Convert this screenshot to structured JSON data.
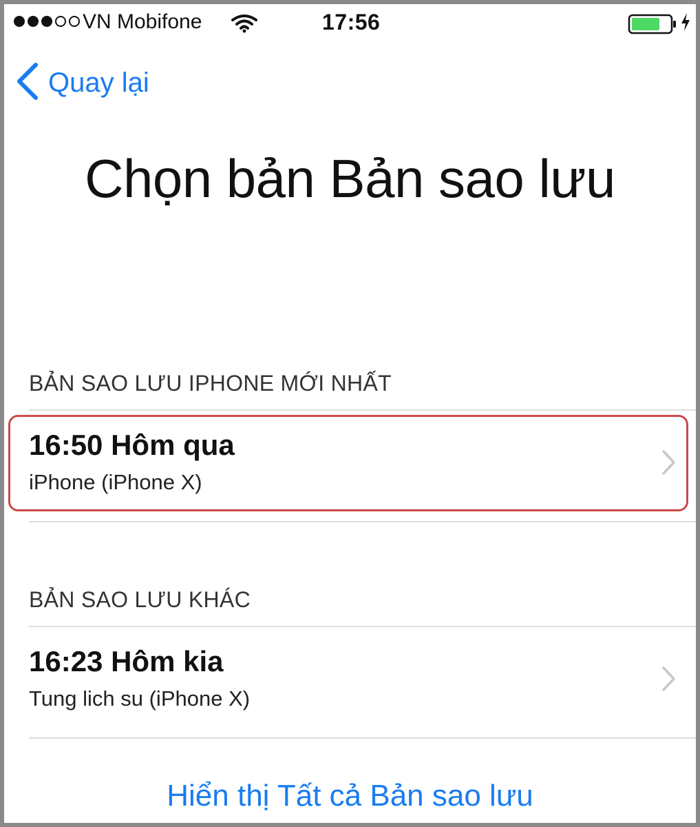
{
  "status_bar": {
    "carrier": "VN Mobifone",
    "time": "17:56",
    "signal_bars_filled": 3,
    "signal_bars_total": 5,
    "wifi_icon": "wifi-icon",
    "battery_icon": "battery-charging-icon",
    "battery_color": "#4cd964"
  },
  "nav": {
    "back_label": "Quay lại",
    "back_icon": "chevron-left-icon"
  },
  "page": {
    "title": "Chọn bản Bản sao lưu"
  },
  "sections": [
    {
      "header": "BẢN SAO LƯU IPHONE MỚI NHẤT",
      "items": [
        {
          "title": "16:50 Hôm qua",
          "subtitle": "iPhone (iPhone X)"
        }
      ]
    },
    {
      "header": "BẢN SAO LƯU KHÁC",
      "items": [
        {
          "title": "16:23 Hôm kia",
          "subtitle": "Tung lich su (iPhone X)"
        }
      ]
    }
  ],
  "show_all_label": "Hiển thị Tất cả Bản sao lưu",
  "colors": {
    "accent": "#1a7cf0",
    "highlight_border": "#c94a4a"
  }
}
